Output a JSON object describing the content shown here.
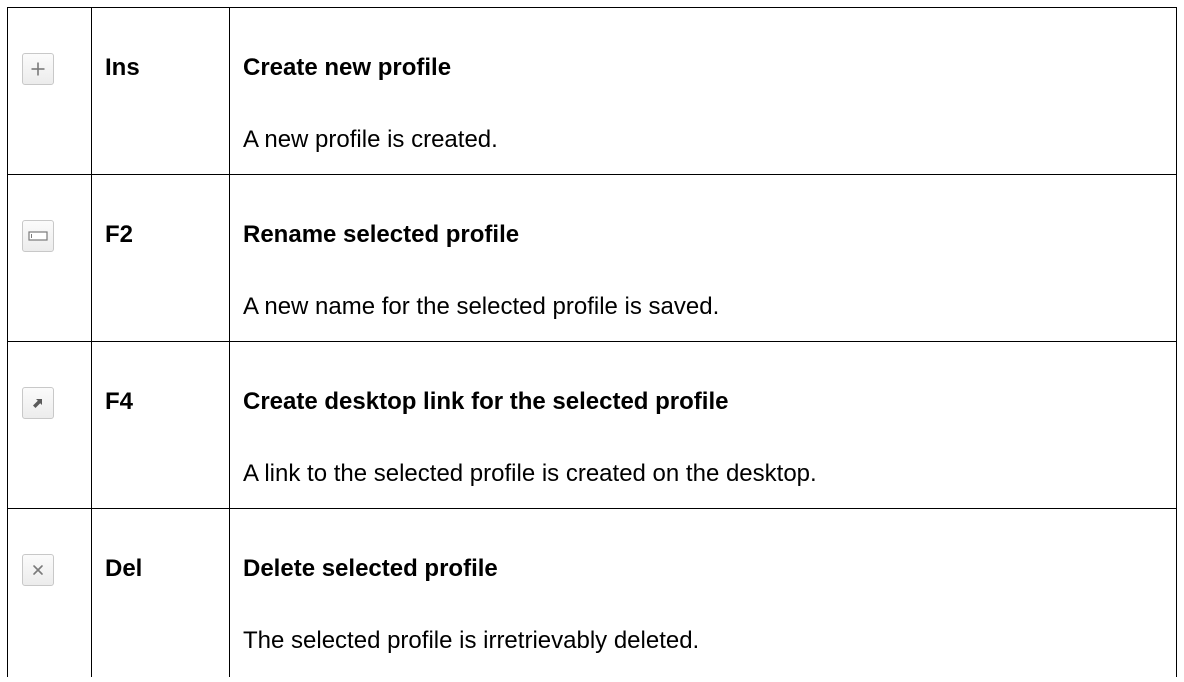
{
  "shortcuts": [
    {
      "icon": "plus-icon",
      "key": "Ins",
      "title": "Create new profile",
      "description": "A new profile is created."
    },
    {
      "icon": "rename-field-icon",
      "key": "F2",
      "title": "Rename selected profile",
      "description": "A new name for the selected profile is saved."
    },
    {
      "icon": "shortcut-arrow-icon",
      "key": "F4",
      "title": "Create desktop link for the selected profile",
      "description": "A link to the selected profile is created on the desktop."
    },
    {
      "icon": "close-x-icon",
      "key": "Del",
      "title": "Delete selected profile",
      "description": "The selected profile is irretrievably deleted."
    }
  ]
}
